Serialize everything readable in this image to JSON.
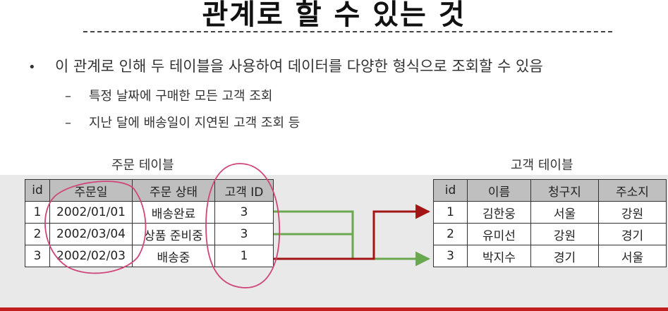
{
  "slide": {
    "title": "관계로 할 수 있는 것",
    "bullet_marker": "•",
    "bullet_text": "이 관계로 인해 두 테이블을 사용하여 데이터를 다양한 형식으로 조회할 수 있음",
    "sub_marker": "–",
    "sub_items": [
      "특정 날짜에 구매한 모든 고객 조회",
      "지난 달에 배송일이 지연된 고객 조회 등"
    ]
  },
  "order_table": {
    "caption": "주문 테이블",
    "headers": [
      "id",
      "주문일",
      "주문 상태",
      "고객 ID"
    ],
    "rows": [
      [
        "1",
        "2002/01/01",
        "배송완료",
        "3"
      ],
      [
        "2",
        "2002/03/04",
        "상품 준비중",
        "3"
      ],
      [
        "3",
        "2002/02/03",
        "배송중",
        "1"
      ]
    ]
  },
  "customer_table": {
    "caption": "고객 테이블",
    "headers": [
      "id",
      "이름",
      "청구지",
      "주소지"
    ],
    "rows": [
      [
        "1",
        "김한웅",
        "서울",
        "강원"
      ],
      [
        "2",
        "유미선",
        "강원",
        "경기"
      ],
      [
        "3",
        "박지수",
        "경기",
        "서울"
      ]
    ]
  },
  "colors": {
    "header_bg": "#bfbfbf",
    "band_bg": "#e9e9e9",
    "link_green": "#6aa84f",
    "link_red": "#a31515",
    "annotation_pink": "#d0457a",
    "bottom_bar": "#c21e1e"
  }
}
